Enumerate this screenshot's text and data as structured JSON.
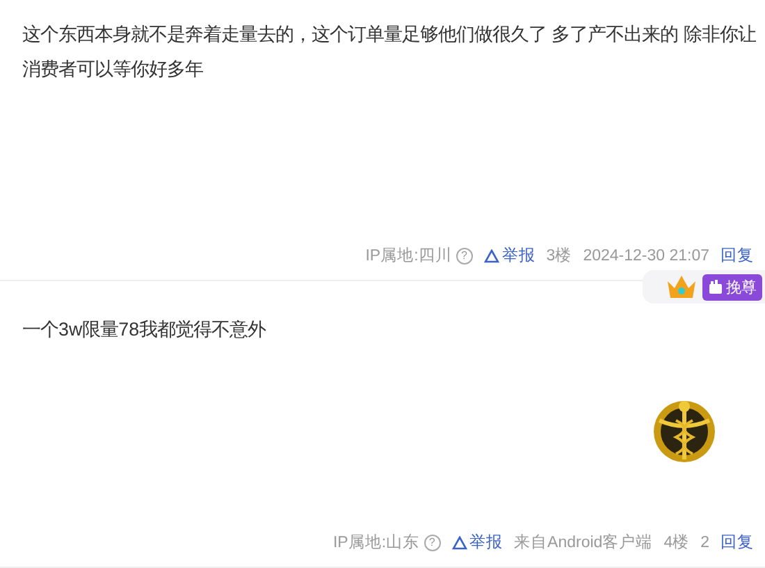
{
  "posts": [
    {
      "content": "这个东西本身就不是奔着走量去的，这个订单量足够他们做很久了 多了产不出来的 除非你让消费者可以等你好多年",
      "footer": {
        "ip": "IP属地:四川",
        "help": "?",
        "report": "举报",
        "floor": "3楼",
        "time": "2024-12-30 21:07",
        "reply": "回复"
      }
    },
    {
      "content": "一个3w限量78我都觉得不意外",
      "footer": {
        "ip": "IP属地:山东",
        "help": "?",
        "report": "举报",
        "client": "来自Android客户端",
        "floor": "4楼",
        "time": "2",
        "reply": "回复"
      },
      "badge": {
        "label": "挽尊"
      },
      "medal": true
    }
  ]
}
